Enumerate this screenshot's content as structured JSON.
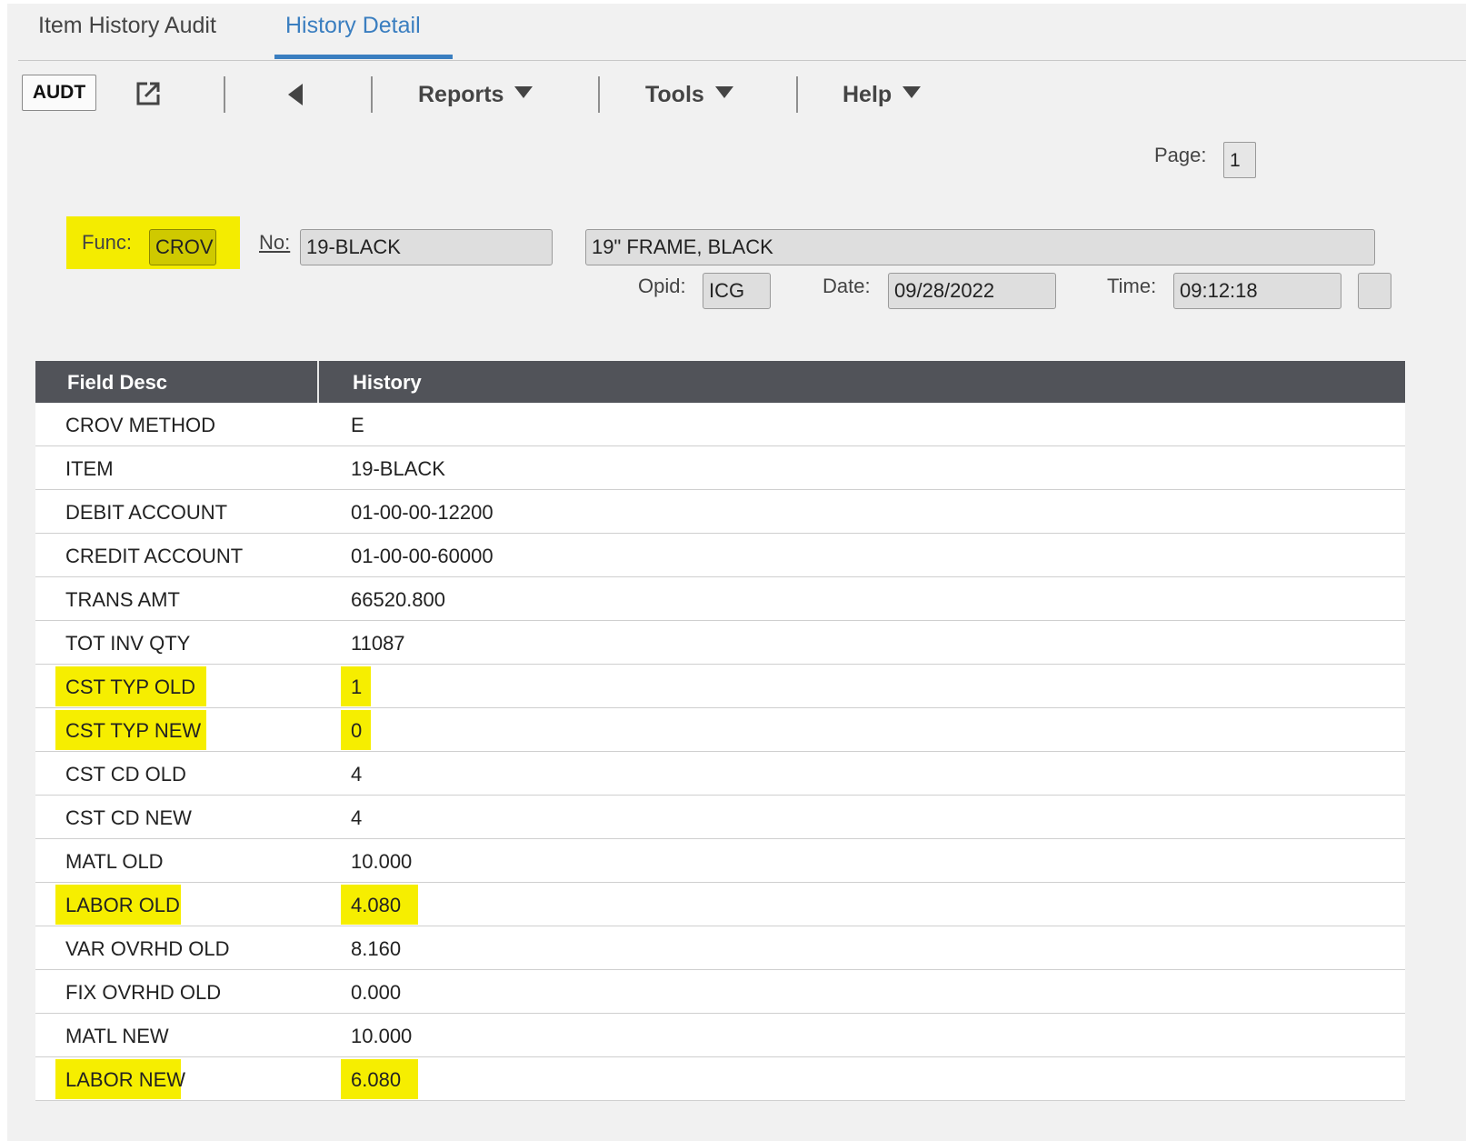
{
  "tabs": [
    {
      "label": "Item History Audit",
      "active": false
    },
    {
      "label": "History Detail",
      "active": true
    }
  ],
  "toolbar": {
    "audt_label": "AUDT",
    "menus": [
      {
        "label": "Reports"
      },
      {
        "label": "Tools"
      },
      {
        "label": "Help"
      }
    ]
  },
  "page": {
    "label": "Page:",
    "value": "1"
  },
  "header": {
    "func_label": "Func:",
    "func_value": "CROV",
    "no_label": "No:",
    "no_value": "19-BLACK",
    "description": "19\" FRAME, BLACK",
    "opid_label": "Opid:",
    "opid_value": "ICG",
    "date_label": "Date:",
    "date_value": "09/28/2022",
    "time_label": "Time:",
    "time_value": "09:12:18"
  },
  "grid": {
    "columns": [
      "Field Desc",
      "History"
    ],
    "rows": [
      {
        "field": "CROV METHOD",
        "value": "E",
        "highlight": false
      },
      {
        "field": "ITEM",
        "value": "19-BLACK",
        "highlight": false
      },
      {
        "field": "DEBIT ACCOUNT",
        "value": "01-00-00-12200",
        "highlight": false
      },
      {
        "field": "CREDIT ACCOUNT",
        "value": "01-00-00-60000",
        "highlight": false
      },
      {
        "field": "TRANS AMT",
        "value": "66520.800",
        "highlight": false
      },
      {
        "field": "TOT INV QTY",
        "value": "11087",
        "highlight": false
      },
      {
        "field": "CST TYP OLD",
        "value": "1",
        "highlight": true
      },
      {
        "field": "CST TYP NEW",
        "value": "0",
        "highlight": true
      },
      {
        "field": "CST CD OLD",
        "value": "4",
        "highlight": false
      },
      {
        "field": "CST CD NEW",
        "value": "4",
        "highlight": false
      },
      {
        "field": "MATL OLD",
        "value": "10.000",
        "highlight": false
      },
      {
        "field": "LABOR OLD",
        "value": "4.080",
        "highlight": true
      },
      {
        "field": "VAR OVRHD OLD",
        "value": "8.160",
        "highlight": false
      },
      {
        "field": "FIX OVRHD OLD",
        "value": "0.000",
        "highlight": false
      },
      {
        "field": "MATL NEW",
        "value": "10.000",
        "highlight": false
      },
      {
        "field": "LABOR NEW",
        "value": "6.080",
        "highlight": true
      }
    ]
  },
  "colors": {
    "highlight": "#f6ee00",
    "accent": "#3a7ec0",
    "grid_header": "#515359"
  }
}
